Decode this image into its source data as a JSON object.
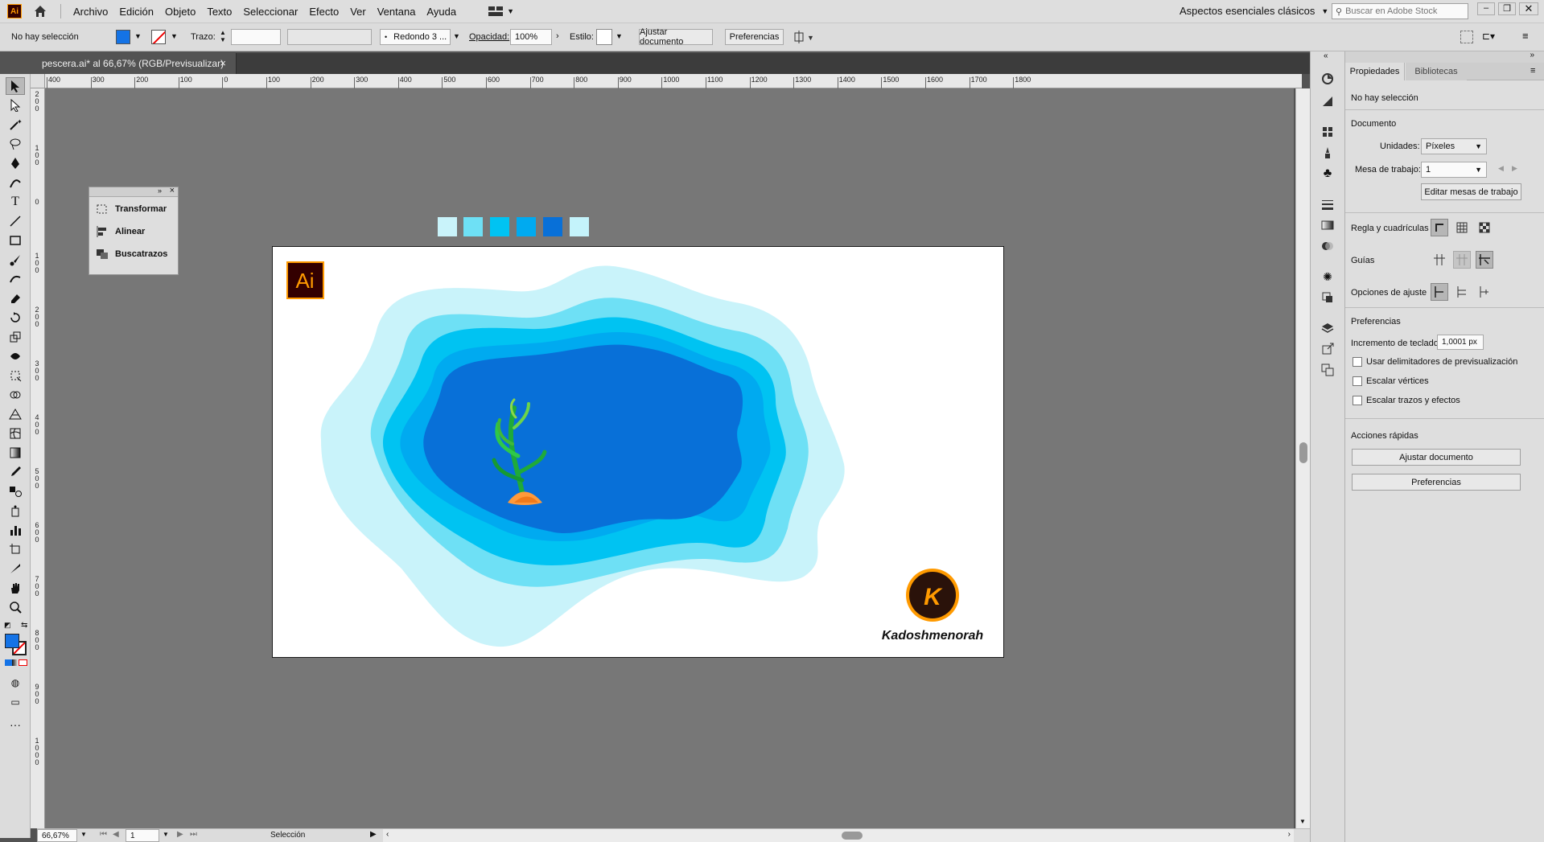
{
  "app": {
    "logo": "Ai",
    "menus": [
      "Archivo",
      "Edición",
      "Objeto",
      "Texto",
      "Seleccionar",
      "Efecto",
      "Ver",
      "Ventana",
      "Ayuda"
    ],
    "workspace": "Aspectos esenciales clásicos",
    "search_placeholder": "Buscar en Adobe Stock"
  },
  "control": {
    "selection": "No hay selección",
    "stroke_label": "Trazo:",
    "brush": "Redondo 3 ...",
    "opacity_label": "Opacidad:",
    "opacity_value": "100%",
    "style_label": "Estilo:",
    "fit_doc": "Ajustar documento",
    "prefs": "Preferencias"
  },
  "doc_tab": {
    "title": "pescera.ai* al 66,67% (RGB/Previsualizar)",
    "close": "×"
  },
  "ruler_top": [
    "400",
    "300",
    "200",
    "100",
    "0",
    "100",
    "200",
    "300",
    "400",
    "500",
    "600",
    "700",
    "800",
    "900",
    "1000",
    "1100",
    "1200",
    "1300",
    "1400",
    "1500",
    "1600",
    "1700",
    "1800"
  ],
  "ruler_left": [
    "200",
    "100",
    "0",
    "100",
    "200",
    "300",
    "400",
    "500",
    "600",
    "700",
    "800",
    "900",
    "1000"
  ],
  "float_panel": {
    "items": [
      "Transformar",
      "Alinear",
      "Buscatrazos"
    ]
  },
  "swatches": [
    "#c9f3fa",
    "#6ee0f5",
    "#00c3f2",
    "#00aaf0",
    "#0870d8",
    "#c4f3fb"
  ],
  "colors": {
    "accent": "#1473e6",
    "water_light": "#c9f3fa",
    "water_mid": "#6ee0f5",
    "water_cyan": "#00c3f2",
    "water_blue": "#00aaf0",
    "water_deep": "#0870d8",
    "ai_orange": "#ff9a00",
    "ai_dark": "#330000"
  },
  "artwork": {
    "ai_logo": "Ai",
    "brand_letter": "K",
    "brand_name": "Kadoshmenorah"
  },
  "status": {
    "zoom": "66,67%",
    "artboard": "1",
    "tool": "Selección"
  },
  "props": {
    "tabs": [
      "Propiedades",
      "Bibliotecas"
    ],
    "no_selection": "No hay selección",
    "doc_title": "Documento",
    "units_label": "Unidades:",
    "units_value": "Píxeles",
    "artboard_label": "Mesa de trabajo:",
    "artboard_value": "1",
    "edit_artboards": "Editar mesas de trabajo",
    "rulers_grids": "Regla y cuadrículas",
    "guides": "Guías",
    "snap_options": "Opciones de ajuste",
    "prefs_title": "Preferencias",
    "key_increment_label": "Incremento de teclado:",
    "key_increment_value": "1,0001 px",
    "cb1": "Usar delimitadores de previsualización",
    "cb2": "Escalar vértices",
    "cb3": "Escalar trazos y efectos",
    "quick_actions": "Acciones rápidas",
    "btn_fit": "Ajustar documento",
    "btn_prefs": "Preferencias"
  }
}
